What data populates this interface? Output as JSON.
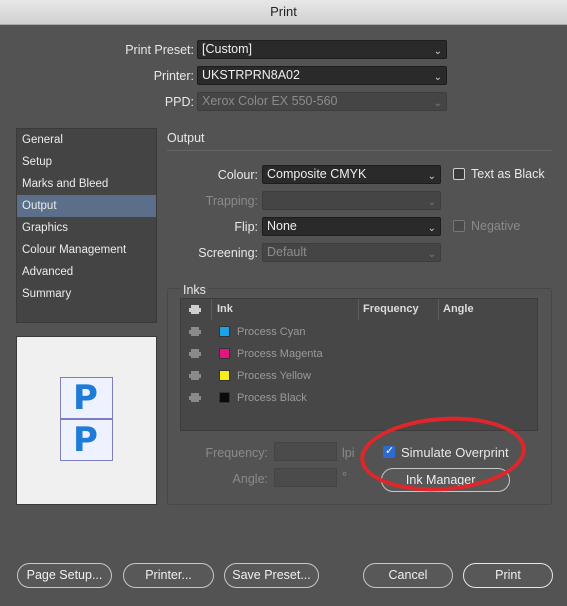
{
  "window": {
    "title": "Print"
  },
  "top": {
    "preset_label": "Print Preset:",
    "preset_value": "[Custom]",
    "printer_label": "Printer:",
    "printer_value": "UKSTRPRN8A02",
    "ppd_label": "PPD:",
    "ppd_value": "Xerox Color EX 550-560"
  },
  "sidebar": {
    "items": [
      {
        "label": "General"
      },
      {
        "label": "Setup"
      },
      {
        "label": "Marks and Bleed"
      },
      {
        "label": "Output"
      },
      {
        "label": "Graphics"
      },
      {
        "label": "Colour Management"
      },
      {
        "label": "Advanced"
      },
      {
        "label": "Summary"
      }
    ],
    "active": "Output"
  },
  "output": {
    "section_title": "Output",
    "colour_label": "Colour:",
    "colour_value": "Composite CMYK",
    "text_as_black_label": "Text as Black",
    "trapping_label": "Trapping:",
    "trapping_value": "",
    "flip_label": "Flip:",
    "flip_value": "None",
    "negative_label": "Negative",
    "screening_label": "Screening:",
    "screening_value": "Default"
  },
  "inks": {
    "group_title": "Inks",
    "columns": [
      "Ink",
      "Frequency",
      "Angle"
    ],
    "rows": [
      {
        "name": "Process Cyan",
        "color": "#1aa3e6"
      },
      {
        "name": "Process Magenta",
        "color": "#e6147f"
      },
      {
        "name": "Process Yellow",
        "color": "#f5ef14"
      },
      {
        "name": "Process Black",
        "color": "#0a0a0a"
      }
    ],
    "frequency_label": "Frequency:",
    "frequency_unit": "lpi",
    "angle_label": "Angle:",
    "angle_unit": "°",
    "simulate_overprint_label": "Simulate Overprint",
    "simulate_overprint_checked": true,
    "ink_manager_label": "Ink Manager..."
  },
  "buttons": {
    "page_setup": "Page Setup...",
    "printer": "Printer...",
    "save_preset": "Save Preset...",
    "cancel": "Cancel",
    "print": "Print"
  }
}
